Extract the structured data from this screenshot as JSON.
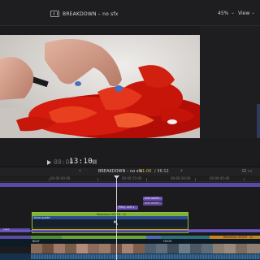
{
  "viewer": {
    "title": "BREAKDOWN – no sfx",
    "zoom": "45%",
    "view_menu": "View"
  },
  "transport": {
    "timecode_dim": "00:00",
    "timecode": "13:10"
  },
  "timeline": {
    "project": "BREAKDOWN – no sfx",
    "current_time": "01:00",
    "duration": "/ 36:12",
    "ruler": [
      "00:00:00:00",
      "00:00:15:00",
      "00:00:30:00",
      "00:00:45:00"
    ]
  },
  "clips": {
    "title_a": "Add additi...",
    "title_b": "Add additi...",
    "title_c": "Pillry Left 1",
    "green_label": "Retention 00003 - In",
    "blue_label": "Intro quote",
    "purple_left": "HMS",
    "story_1": "BEAT",
    "story_2": "HOOK",
    "story_3": "Retention 00003 - In"
  },
  "colors": {
    "accent_yellow": "#e0b84a",
    "clip_green": "#7db33a",
    "title_purple": "#6d4fb8",
    "clip_blue": "#2d4d8c"
  }
}
